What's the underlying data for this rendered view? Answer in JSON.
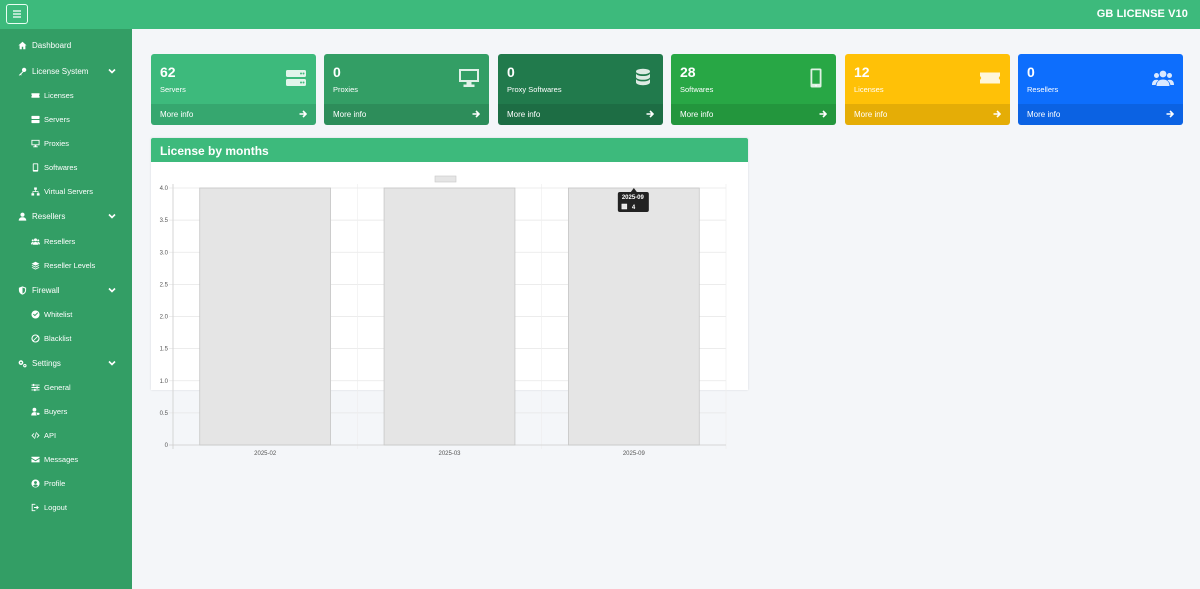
{
  "header": {
    "brand": "GB LICENSE V10"
  },
  "sidebar": {
    "items": [
      {
        "label": "Dashboard",
        "icon": "home-icon"
      },
      {
        "label": "License System",
        "icon": "key-icon",
        "expandable": true
      },
      {
        "label": "Licenses",
        "icon": "ticket-icon"
      },
      {
        "label": "Servers",
        "icon": "server-icon"
      },
      {
        "label": "Proxies",
        "icon": "desktop-icon"
      },
      {
        "label": "Softwares",
        "icon": "mobile-icon"
      },
      {
        "label": "Virtual Servers",
        "icon": "network-icon"
      },
      {
        "label": "Resellers",
        "icon": "user-icon",
        "expandable": true
      },
      {
        "label": "Resellers",
        "icon": "users-icon"
      },
      {
        "label": "Reseller Levels",
        "icon": "layers-icon"
      },
      {
        "label": "Firewall",
        "icon": "shield-icon",
        "expandable": true
      },
      {
        "label": "Whitelist",
        "icon": "check-circle-icon"
      },
      {
        "label": "Blacklist",
        "icon": "ban-icon"
      },
      {
        "label": "Settings",
        "icon": "cogs-icon",
        "expandable": true
      },
      {
        "label": "General",
        "icon": "sliders-icon"
      },
      {
        "label": "Buyers",
        "icon": "user-tag-icon"
      },
      {
        "label": "API",
        "icon": "code-icon"
      },
      {
        "label": "Messages",
        "icon": "envelope-icon"
      },
      {
        "label": "Profile",
        "icon": "user-circle-icon"
      },
      {
        "label": "Logout",
        "icon": "sign-out-icon"
      }
    ]
  },
  "cards": [
    {
      "value": "62",
      "label": "Servers",
      "more": "More info",
      "color": "#3dba7c",
      "icon": "server-icon"
    },
    {
      "value": "0",
      "label": "Proxies",
      "more": "More info",
      "color": "#339e65",
      "icon": "desktop-icon"
    },
    {
      "value": "0",
      "label": "Proxy Softwares",
      "more": "More info",
      "color": "#217a4c",
      "icon": "database-icon"
    },
    {
      "value": "28",
      "label": "Softwares",
      "more": "More info",
      "color": "#28a745",
      "icon": "mobile-icon"
    },
    {
      "value": "12",
      "label": "Licenses",
      "more": "More info",
      "color": "#ffc107",
      "icon": "ticket-icon"
    },
    {
      "value": "0",
      "label": "Resellers",
      "more": "More info",
      "color": "#0d6efd",
      "icon": "users-icon"
    }
  ],
  "panel": {
    "title": "License by months"
  },
  "chart_data": {
    "type": "bar",
    "categories": [
      "2025-02",
      "2025-03",
      "2025-09"
    ],
    "values": [
      4,
      4,
      4
    ],
    "ylim": [
      0,
      4
    ],
    "yticks": [
      "0",
      "0.5",
      "1.0",
      "1.5",
      "2.0",
      "2.5",
      "3.0",
      "3.5",
      "4.0"
    ],
    "grid": true,
    "legend": "top-center",
    "bar_color": "#e5e5e5",
    "tooltip": {
      "category": "2025-09",
      "value": "4"
    }
  }
}
